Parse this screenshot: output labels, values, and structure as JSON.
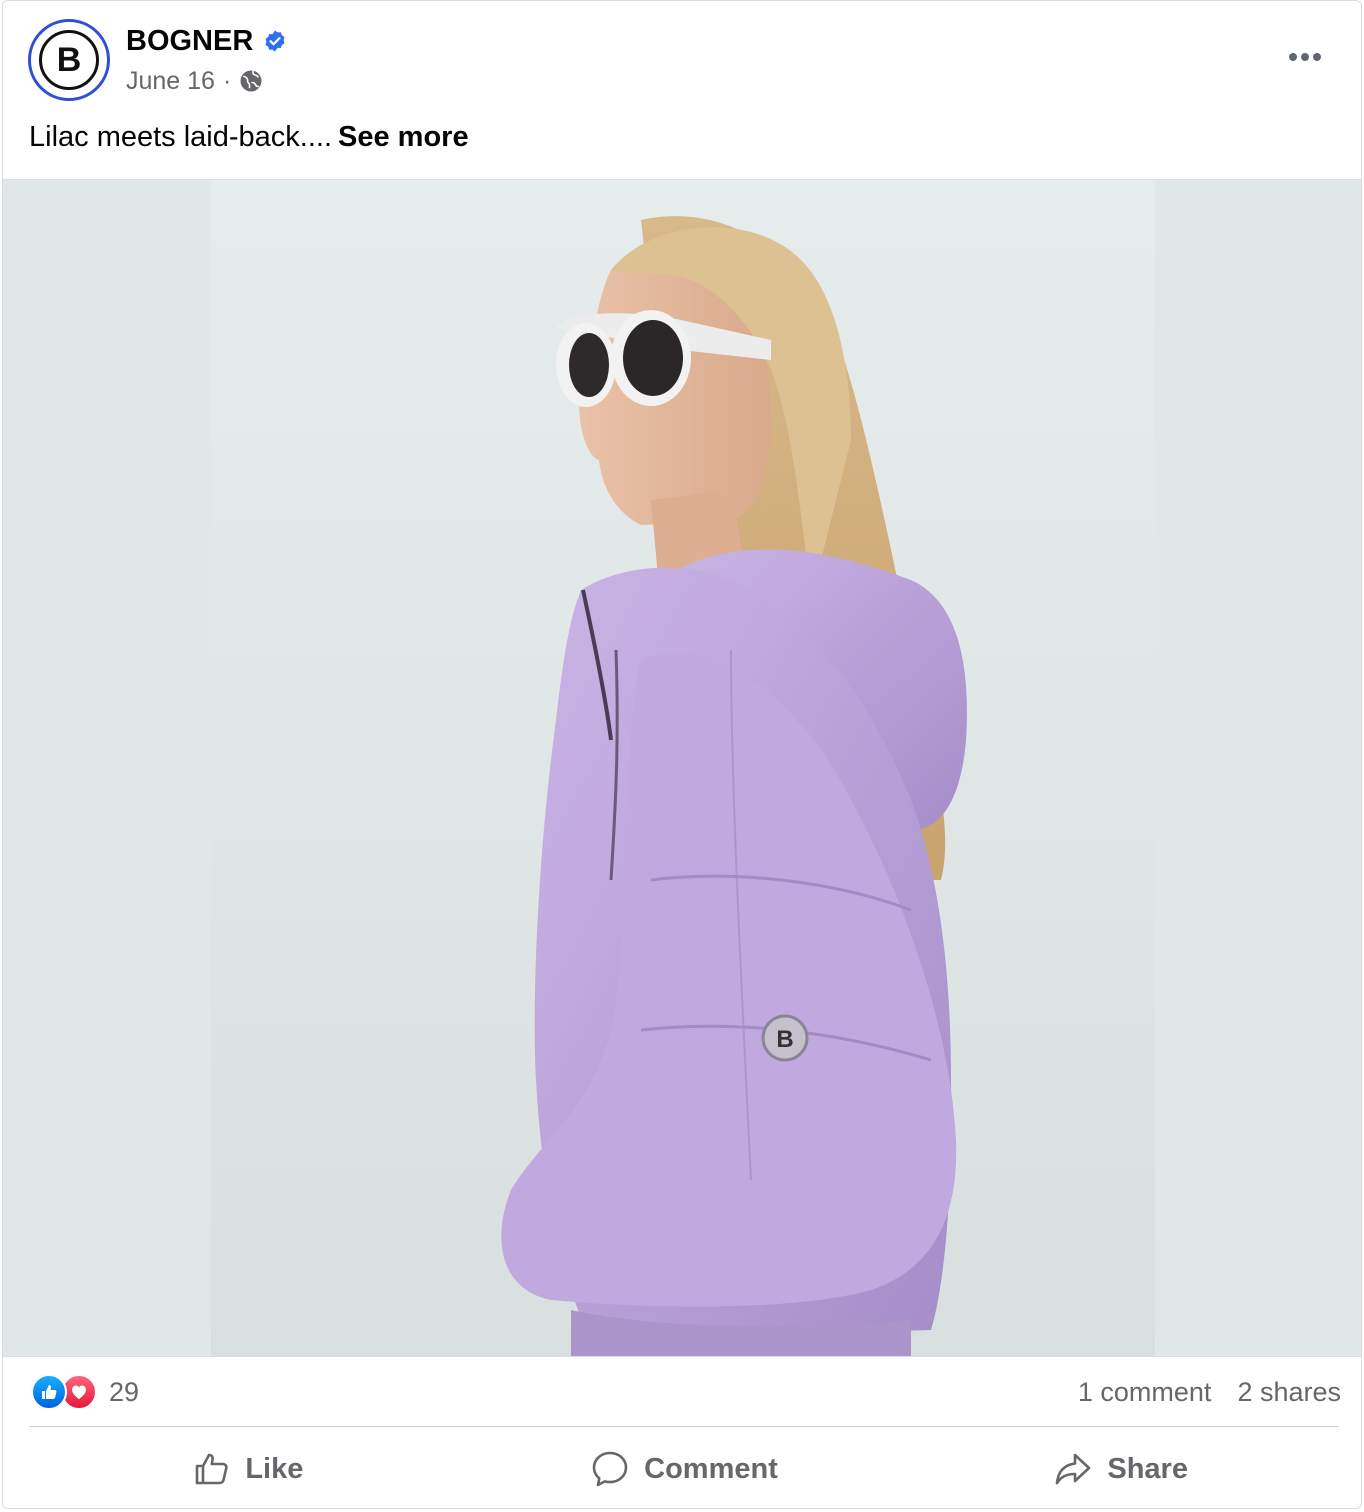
{
  "post": {
    "page_name": "BOGNER",
    "avatar_letter": "B",
    "date": "June 16",
    "separator": "·",
    "caption": "Lilac meets laid-back....",
    "see_more": "See more",
    "image_logo_letter": "B"
  },
  "stats": {
    "reaction_count": "29",
    "comments": "1 comment",
    "shares": "2 shares"
  },
  "actions": {
    "like": "Like",
    "comment": "Comment",
    "share": "Share"
  },
  "colors": {
    "verified_blue": "#2e6ff2",
    "like_blue": "#1877f2",
    "love_red": "#e61739",
    "jacket_lilac": "#b9a1d8"
  },
  "icons": [
    "verified-badge-icon",
    "globe-icon",
    "more-options-icon",
    "like-reaction-icon",
    "love-reaction-icon",
    "thumbs-up-icon",
    "comment-bubble-icon",
    "share-arrow-icon"
  ]
}
